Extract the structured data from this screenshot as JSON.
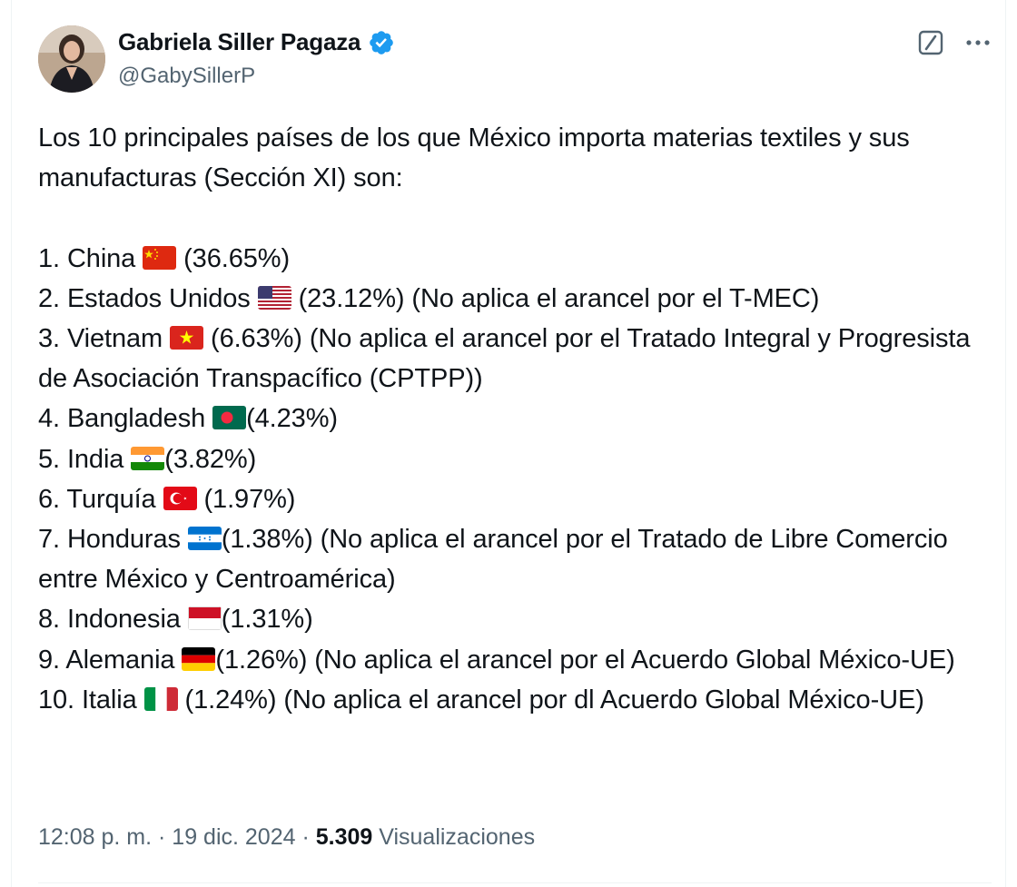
{
  "author": {
    "name": "Gabriela Siller Pagaza",
    "handle": "@GabySillerP"
  },
  "tweet": {
    "intro": "Los 10 principales países de los que México importa materias textiles y sus manufacturas (Sección XI) son:",
    "items": [
      {
        "before": "1. China ",
        "flag": "china-flag-icon",
        "after": " (36.65%)"
      },
      {
        "before": "2. Estados Unidos ",
        "flag": "usa-flag-icon",
        "after": " (23.12%) (No aplica el arancel por el T-MEC)"
      },
      {
        "before": "3. Vietnam ",
        "flag": "vietnam-flag-icon",
        "after": " (6.63%) (No aplica el arancel por el Tratado Integral y Progresista de Asociación Transpacífico (CPTPP))"
      },
      {
        "before": "4. Bangladesh ",
        "flag": "bangladesh-flag-icon",
        "after": "(4.23%)"
      },
      {
        "before": "5. India ",
        "flag": "india-flag-icon",
        "after": "(3.82%)"
      },
      {
        "before": "6. Turquía ",
        "flag": "turkey-flag-icon",
        "after": " (1.97%)"
      },
      {
        "before": "7. Honduras ",
        "flag": "honduras-flag-icon",
        "after": "(1.38%) (No aplica el arancel por el Tratado de Libre Comercio entre México y Centroamérica)"
      },
      {
        "before": "8. Indonesia ",
        "flag": "indonesia-flag-icon",
        "after": "(1.31%)"
      },
      {
        "before": "9. Alemania ",
        "flag": "germany-flag-icon",
        "after": "(1.26%) (No aplica el arancel por el Acuerdo Global México-UE)"
      },
      {
        "before": "10. Italia ",
        "flag": "italy-flag-icon",
        "after": " (1.24%) (No aplica el arancel por dl Acuerdo Global México-UE)"
      }
    ]
  },
  "meta": {
    "time": "12:08 p. m.",
    "sep": " · ",
    "date": "19 dic. 2024",
    "views_count": "5.309",
    "views_label": " Visualizaciones"
  },
  "colors": {
    "text": "#0f1419",
    "secondary": "#536471",
    "verified": "#1d9bf0"
  }
}
